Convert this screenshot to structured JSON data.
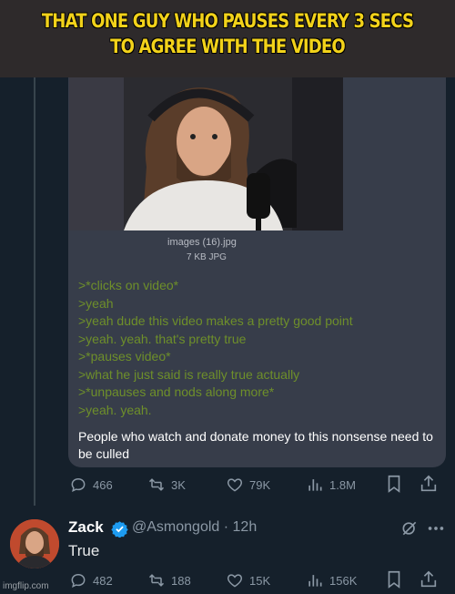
{
  "meme": {
    "caption": "THAT ONE GUY WHO PAUSES EVERY 3 SECS TO AGREE WITH THE VIDEO"
  },
  "quote": {
    "image": {
      "file_name": "images (16).jpg",
      "file_meta": "7 KB JPG"
    },
    "greentext": [
      ">*clicks on video*",
      ">yeah",
      ">yeah dude this video makes a pretty good point",
      ">yeah. yeah. that's pretty true",
      ">*pauses video*",
      ">what he just said is really true actually",
      ">*unpauses and nods along more*",
      ">yeah. yeah."
    ],
    "body": "People who watch and donate money to this nonsense need to be culled"
  },
  "post_actions": {
    "replies": "466",
    "reposts": "3K",
    "likes": "79K",
    "views": "1.8M"
  },
  "reply": {
    "name": "Zack",
    "handle": "@Asmongold",
    "time": "12h",
    "text": "True",
    "actions": {
      "replies": "482",
      "reposts": "188",
      "likes": "15K",
      "views": "156K"
    }
  },
  "watermark": "imgflip.com",
  "colors": {
    "background": "#15202b",
    "caption": "#f2d21a",
    "greentext": "#6e8f2a",
    "verified": "#1d9bf0"
  }
}
